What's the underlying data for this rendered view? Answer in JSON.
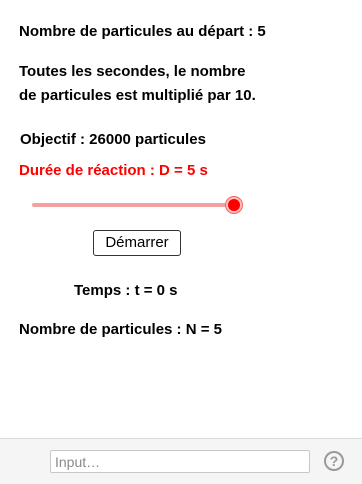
{
  "panel": {
    "initial_particles": "Nombre de particules au départ : 5",
    "rule_line1": "Toutes les secondes, le nombre",
    "rule_line2": "de particules est multiplié par 10.",
    "objective": "Objectif : 26000 particules",
    "duration_label": "Durée de réaction : D = 5 s",
    "duration_slider_value": 1.0,
    "start_button": "Démarrer",
    "time_label": "Temps : t = 0 s",
    "count_label": "Nombre de particules : N = 5"
  },
  "input_bar": {
    "placeholder": "Input…",
    "help_icon_glyph": "?"
  },
  "colors": {
    "accent_red": "#ff0000",
    "slider_track": "#f4a0a0"
  }
}
